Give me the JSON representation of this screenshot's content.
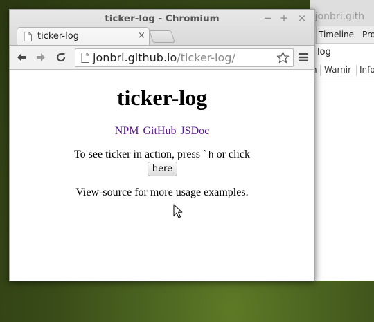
{
  "background_window": {
    "title_partial": "/jonbri.gith",
    "tabs": [
      "Timeline",
      "Pro"
    ],
    "row_text": "log",
    "filters": [
      "n",
      "Warnir",
      "Info"
    ]
  },
  "window": {
    "title": "ticker-log - Chromium",
    "controls": {
      "minimize": "−",
      "maximize": "+",
      "close": "×"
    }
  },
  "tab": {
    "label": "ticker-log",
    "close": "×"
  },
  "omnibox": {
    "host": "jonbri.github.io",
    "path": "/ticker-log/"
  },
  "page": {
    "heading": "ticker-log",
    "links": [
      "NPM",
      "GitHub",
      "JSDoc"
    ],
    "instruction_prefix": "To see ticker in action, press ",
    "instruction_key": "`h",
    "instruction_suffix": " or click",
    "button_label": "here",
    "footer_text": "View-source for more usage examples."
  },
  "icons": {
    "back": "arrow-left-icon",
    "forward": "arrow-right-icon",
    "reload": "reload-icon",
    "page": "page-icon",
    "bookmark": "star-icon",
    "menu": "hamburger-menu-icon",
    "cursor": "mouse-cursor-icon"
  },
  "colors": {
    "link_visited": "#551a8b",
    "desktop": "#3d4d1c",
    "chrome_frame": "#d7d7d7"
  }
}
